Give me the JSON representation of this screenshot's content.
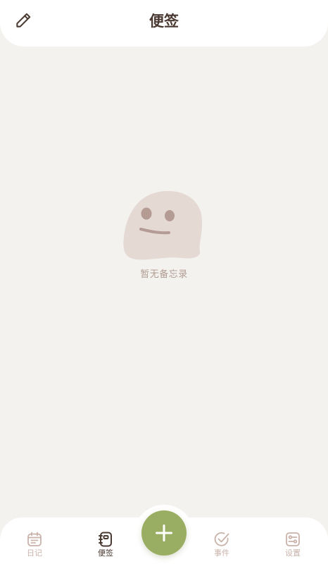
{
  "header": {
    "title": "便签",
    "edit_icon": "pencil-icon"
  },
  "empty_state": {
    "message": "暂无备忘录",
    "illustration": "neutral-face-blob"
  },
  "bottom_nav": {
    "items": [
      {
        "label": "日记",
        "icon": "calendar-icon",
        "active": false
      },
      {
        "label": "便签",
        "icon": "notebook-icon",
        "active": true
      },
      {
        "label": "事件",
        "icon": "check-circle-icon",
        "active": false
      },
      {
        "label": "设置",
        "icon": "settings-toggle-icon",
        "active": false
      }
    ],
    "fab_icon": "plus-icon"
  },
  "colors": {
    "background": "#f4f2ef",
    "surface": "#ffffff",
    "text_primary": "#4a3a32",
    "text_muted": "#b09c92",
    "nav_inactive": "#c9b2aa",
    "accent": "#9aae63",
    "blob": "#e5d9d4",
    "blob_features": "#b49b93"
  }
}
